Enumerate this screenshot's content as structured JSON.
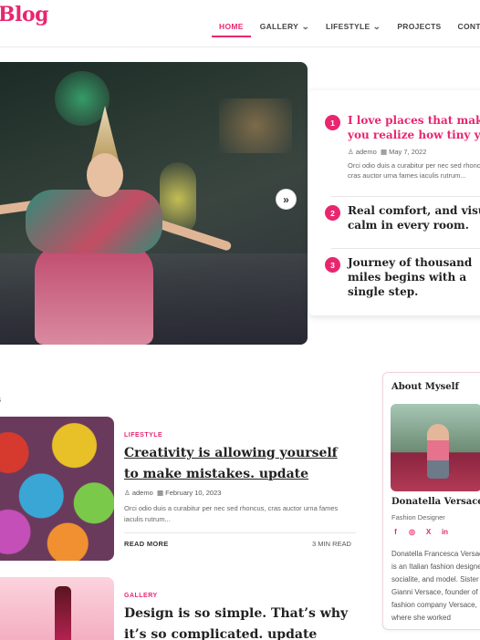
{
  "site": {
    "logo": "Blog",
    "tagline": "."
  },
  "nav": {
    "items": [
      {
        "label": "HOME",
        "active": true,
        "dropdown": false
      },
      {
        "label": "GALLERY",
        "active": false,
        "dropdown": true
      },
      {
        "label": "LIFESTYLE",
        "active": false,
        "dropdown": true
      },
      {
        "label": "PROJECTS",
        "active": false,
        "dropdown": false
      },
      {
        "label": "CONTACT",
        "active": false,
        "dropdown": false
      }
    ]
  },
  "hero": {
    "next_icon": "double-chevron-right-icon",
    "next_glyph": "»"
  },
  "trending": [
    {
      "num": "1",
      "title": "I love places that make you realize how tiny you.",
      "author": "ademo",
      "date": "May 7, 2022",
      "excerpt": "Orci odio duis a curabitur per nec sed rhoncus, cras auctor urna fames iaculis rutrum..."
    },
    {
      "num": "2",
      "title": "Real comfort, and visual calm in every room."
    },
    {
      "num": "3",
      "title": "Journey of thousand miles begins with a single step."
    }
  ],
  "posts_heading": "ts",
  "posts": [
    {
      "category": "LIFESTYLE",
      "title": "Creativity is allowing yourself to make mistakes. update",
      "author": "ademo",
      "date": "February 10, 2023",
      "excerpt": "Orci odio duis a curabitur per nec sed rhoncus, cras auctor urna fames iaculis rutrum...",
      "read_more": "READ MORE",
      "read_time": "3 MIN READ"
    },
    {
      "category": "GALLERY",
      "title": "Design is so simple. That’s why it’s so complicated. update"
    }
  ],
  "about": {
    "title": "About Myself",
    "name": "Donatella Versace",
    "role": "Fashion Designer",
    "socials": [
      "f",
      "◎",
      "X",
      "in"
    ],
    "bio": "Donatella Francesca Versace is an Italian fashion designer, socialite, and model. Sister of Gianni Versace, founder of the fashion company Versace, where she worked"
  },
  "colors": {
    "accent": "#e8266f"
  }
}
